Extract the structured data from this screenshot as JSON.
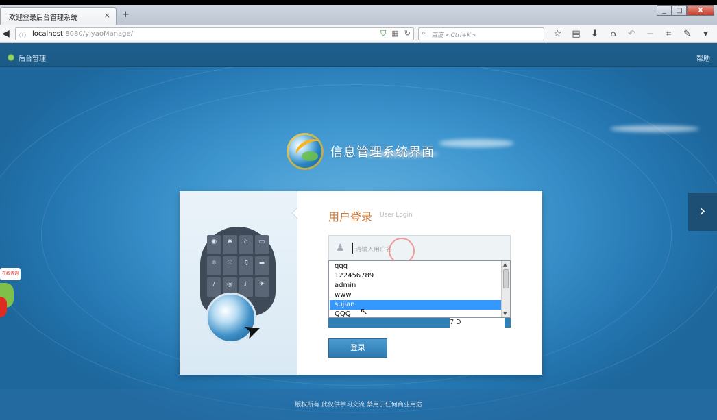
{
  "browser": {
    "tab_title": "欢迎登录后台管理系统",
    "tab_close": "×",
    "new_tab": "+",
    "window_buttons": [
      "_",
      "□",
      "X"
    ],
    "url_host": "localhost",
    "url_rest": ":8080/yiyaoManage/",
    "search_placeholder": "百度 <Ctrl+K>"
  },
  "header": {
    "title": "后台管理",
    "help": "帮助"
  },
  "logo": {
    "text": "信息管理系统界面"
  },
  "login": {
    "title": "用户登录",
    "subtitle": "User Login",
    "username_placeholder": "请输入用户名",
    "autocomplete": [
      "qqq",
      "122456789",
      "admin",
      "www",
      "sujian",
      "QQQ"
    ],
    "selected_index": 4,
    "captcha_peek": "7 Ɔ",
    "submit_label": "登录"
  },
  "footer": {
    "text": "版权所有  此仅供学习交流    禁用于任何商业用途"
  },
  "nav": {
    "next_arrow": "›"
  }
}
